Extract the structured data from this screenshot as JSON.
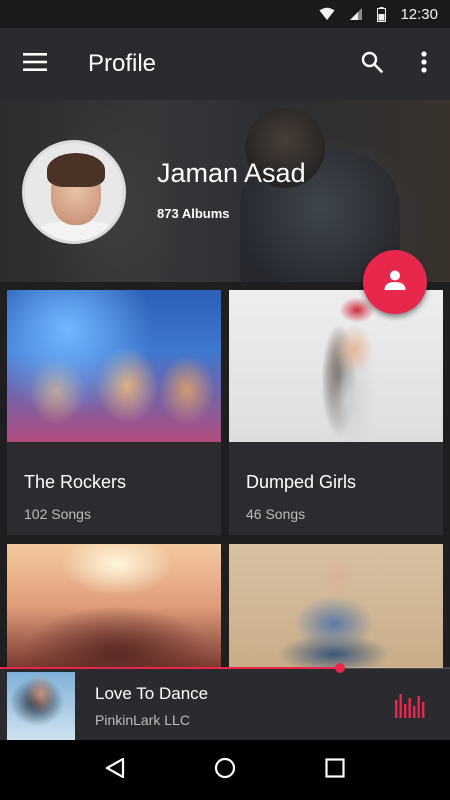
{
  "status_bar": {
    "time": "12:30",
    "icons": [
      "wifi-icon",
      "signal-icon",
      "battery-icon"
    ]
  },
  "app_bar": {
    "title": "Profile",
    "icons": [
      "menu-icon",
      "search-icon",
      "more-vert-icon"
    ]
  },
  "profile": {
    "name": "Jaman Asad",
    "albums_label": "873 Albums"
  },
  "fab": {
    "icon": "person-icon",
    "color": "#e8274d"
  },
  "albums": [
    {
      "title": "The Rockers",
      "subtitle": "102 Songs"
    },
    {
      "title": "Dumped Girls",
      "subtitle": "46 Songs"
    },
    {
      "title": "",
      "subtitle": ""
    },
    {
      "title": "",
      "subtitle": ""
    }
  ],
  "now_playing": {
    "title": "Love To Dance",
    "artist": "PinkinLark LLC",
    "progress": 0.755,
    "icon": "equalizer-icon"
  },
  "nav_bar": {
    "icons": [
      "back-icon",
      "home-icon",
      "recents-icon"
    ]
  },
  "colors": {
    "accent": "#e8274d",
    "app_bar": "#2b2b2f",
    "background": "#1c1c1e",
    "card": "#2c2c30"
  }
}
